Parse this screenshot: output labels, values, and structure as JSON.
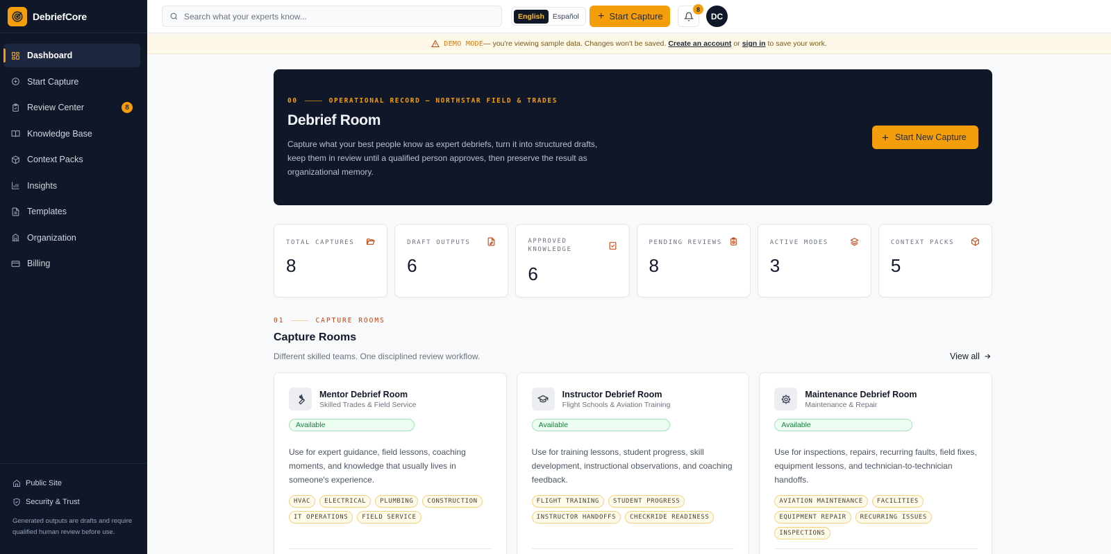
{
  "app": {
    "name": "DebriefCore"
  },
  "sidebar": {
    "items": [
      {
        "label": "Dashboard",
        "icon": "dashboard-icon",
        "active": true
      },
      {
        "label": "Start Capture",
        "icon": "plus-circle-icon"
      },
      {
        "label": "Review Center",
        "icon": "clipboard-check-icon",
        "badge": "8"
      },
      {
        "label": "Knowledge Base",
        "icon": "book-icon"
      },
      {
        "label": "Context Packs",
        "icon": "package-icon"
      },
      {
        "label": "Insights",
        "icon": "bar-chart-icon"
      },
      {
        "label": "Templates",
        "icon": "file-text-icon"
      },
      {
        "label": "Organization",
        "icon": "building-icon"
      },
      {
        "label": "Billing",
        "icon": "credit-card-icon"
      }
    ],
    "footer": {
      "public_site": "Public Site",
      "security": "Security & Trust",
      "note": "Generated outputs are drafts and require qualified human review before use."
    }
  },
  "topbar": {
    "search_placeholder": "Search what your experts know...",
    "lang_active": "English",
    "lang_other": "Español",
    "start_capture": "Start Capture",
    "notification_count": "8",
    "avatar_initials": "DC"
  },
  "banner": {
    "tag": "DEMO MODE",
    "text": "— you're viewing sample data. Changes won't be saved.",
    "create_account": "Create an account",
    "or": "or",
    "sign_in": "sign in",
    "suffix": "to save your work."
  },
  "hero": {
    "index": "00",
    "eyebrow": "OPERATIONAL RECORD — NORTHSTAR FIELD & TRADES",
    "title": "Debrief Room",
    "description": "Capture what your best people know as expert debriefs, turn it into structured drafts, keep them in review until a qualified person approves, then preserve the result as organizational memory.",
    "cta": "Start New Capture"
  },
  "stats": [
    {
      "label": "TOTAL CAPTURES",
      "value": "8",
      "icon": "folder-open-icon"
    },
    {
      "label": "DRAFT OUTPUTS",
      "value": "6",
      "icon": "file-edit-icon"
    },
    {
      "label": "APPROVED KNOWLEDGE",
      "value": "6",
      "icon": "check-square-icon"
    },
    {
      "label": "PENDING REVIEWS",
      "value": "8",
      "icon": "clipboard-clock-icon"
    },
    {
      "label": "ACTIVE MODES",
      "value": "3",
      "icon": "layers-icon"
    },
    {
      "label": "CONTEXT PACKS",
      "value": "5",
      "icon": "package-icon"
    }
  ],
  "capture_rooms": {
    "index": "01",
    "eyebrow": "CAPTURE ROOMS",
    "title": "Capture Rooms",
    "subtitle": "Different skilled teams. One disciplined review workflow.",
    "view_all": "View all",
    "rooms": [
      {
        "name": "Mentor Debrief Room",
        "category": "Skilled Trades & Field Service",
        "status": "Available",
        "icon": "wrench-icon",
        "description": "Use for expert guidance, field lessons, coaching moments, and knowledge that usually lives in someone's experience.",
        "tags": [
          "HVAC",
          "ELECTRICAL",
          "PLUMBING",
          "CONSTRUCTION",
          "IT OPERATIONS",
          "FIELD SERVICE"
        ]
      },
      {
        "name": "Instructor Debrief Room",
        "category": "Flight Schools & Aviation Training",
        "status": "Available",
        "icon": "graduation-cap-icon",
        "description": "Use for training lessons, student progress, skill development, instructional observations, and coaching feedback.",
        "tags": [
          "FLIGHT TRAINING",
          "STUDENT PROGRESS",
          "INSTRUCTOR HANDOFFS",
          "CHECKRIDE READINESS"
        ]
      },
      {
        "name": "Maintenance Debrief Room",
        "category": "Maintenance & Repair",
        "status": "Available",
        "icon": "gear-icon",
        "description": "Use for inspections, repairs, recurring faults, field fixes, equipment lessons, and technician-to-technician handoffs.",
        "tags": [
          "AVIATION MAINTENANCE",
          "FACILITIES",
          "EQUIPMENT REPAIR",
          "RECURRING ISSUES",
          "INSPECTIONS"
        ]
      }
    ]
  }
}
